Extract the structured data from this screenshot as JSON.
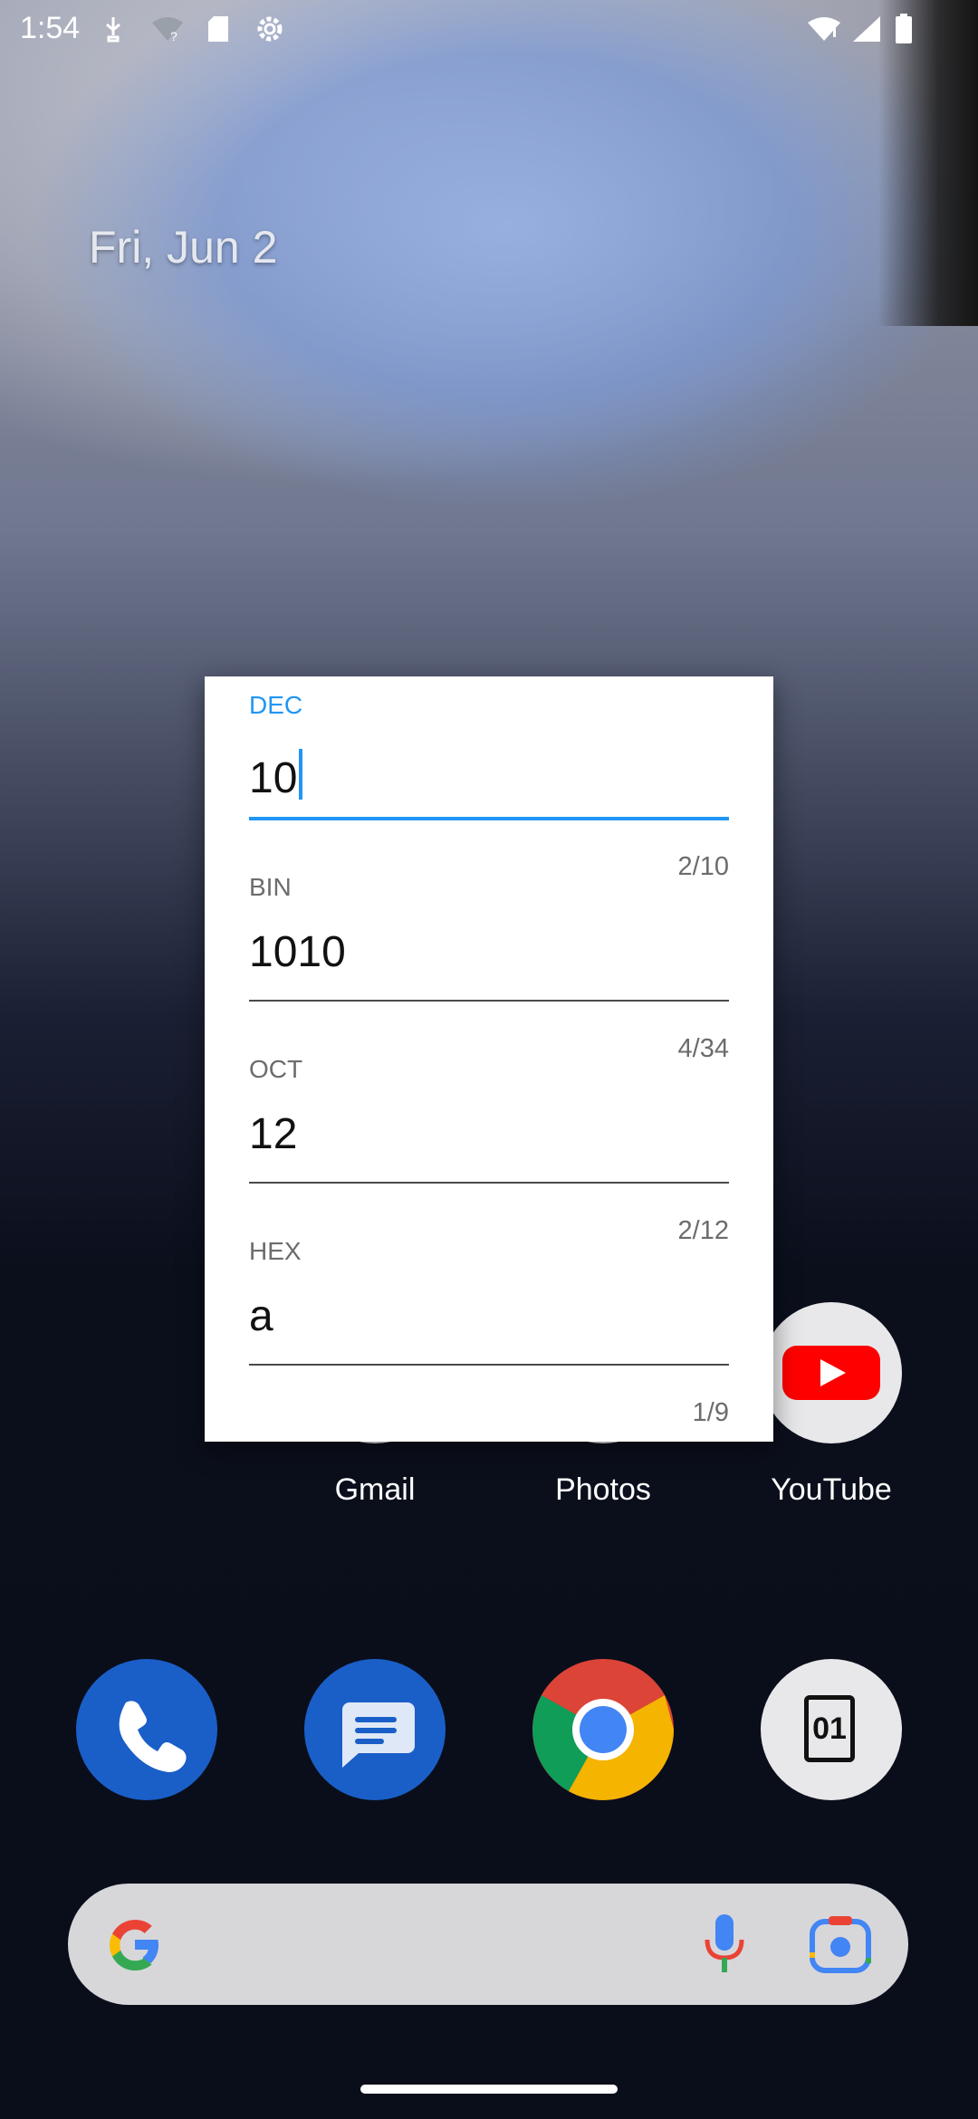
{
  "status_bar": {
    "time": "1:54"
  },
  "home": {
    "date": "Fri, Jun 2",
    "apps_row": [
      {
        "label": "Gmail"
      },
      {
        "label": "Photos"
      },
      {
        "label": "YouTube"
      }
    ],
    "dock": [
      {
        "name": "phone"
      },
      {
        "name": "messages"
      },
      {
        "name": "chrome"
      },
      {
        "name": "binary-converter"
      }
    ],
    "binary_icon_text": "01"
  },
  "dialog": {
    "fields": [
      {
        "label": "DEC",
        "value": "10",
        "counter": "2/10",
        "focused": true
      },
      {
        "label": "BIN",
        "value": "1010",
        "counter": "4/34",
        "focused": false
      },
      {
        "label": "OCT",
        "value": "12",
        "counter": "2/12",
        "focused": false
      },
      {
        "label": "HEX",
        "value": "a",
        "counter": "1/9",
        "focused": false
      }
    ]
  },
  "colors": {
    "accent": "#2196f3",
    "youtube_red": "#ff0000",
    "dock_blue": "#1a5fc8"
  }
}
